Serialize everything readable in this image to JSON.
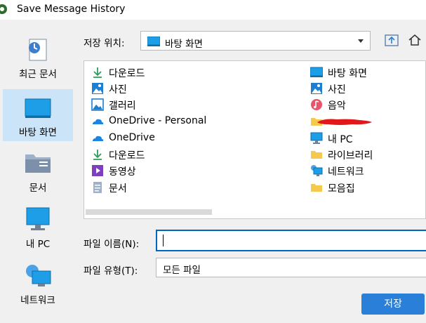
{
  "window": {
    "title": "Save Message History"
  },
  "sidebar": {
    "items": [
      {
        "label": "최근 문서",
        "icon": "recent-places-icon"
      },
      {
        "label": "바탕 화면",
        "icon": "desktop-icon",
        "selected": true
      },
      {
        "label": "문서",
        "icon": "documents-folder-icon"
      },
      {
        "label": "내 PC",
        "icon": "this-pc-icon"
      },
      {
        "label": "네트워크",
        "icon": "network-icon"
      }
    ]
  },
  "location": {
    "label": "저장 위치:",
    "value": "바탕 화면",
    "icon": "desktop-icon"
  },
  "files": [
    {
      "name": "다운로드",
      "icon": "downloads-icon"
    },
    {
      "name": "사진",
      "icon": "pictures-icon"
    },
    {
      "name": "갤러리",
      "icon": "gallery-icon"
    },
    {
      "name": "OneDrive - Personal",
      "icon": "onedrive-icon"
    },
    {
      "name": "OneDrive",
      "icon": "onedrive-icon"
    },
    {
      "name": "다운로드",
      "icon": "downloads-icon"
    },
    {
      "name": "동영상",
      "icon": "videos-icon"
    },
    {
      "name": "문서",
      "icon": "document-icon"
    },
    {
      "name": "바탕 화면",
      "icon": "desktop-icon"
    },
    {
      "name": "사진",
      "icon": "pictures-icon"
    },
    {
      "name": "음악",
      "icon": "music-icon"
    },
    {
      "name": "",
      "icon": "folder-icon",
      "redacted": true
    },
    {
      "name": "내 PC",
      "icon": "this-pc-icon"
    },
    {
      "name": "라이브러리",
      "icon": "folder-icon"
    },
    {
      "name": "네트워크",
      "icon": "network-icon"
    },
    {
      "name": "모음집",
      "icon": "folder-icon"
    }
  ],
  "filename": {
    "label": "파일 이름(N):",
    "value": ""
  },
  "filetype": {
    "label": "파일 유형(T):",
    "value": "모든 파일"
  },
  "buttons": {
    "save": "저장"
  },
  "colors": {
    "accent": "#0067c0",
    "save_button": "#2a7fd8",
    "selection": "#cce4f7",
    "redaction": "#e0181c"
  }
}
